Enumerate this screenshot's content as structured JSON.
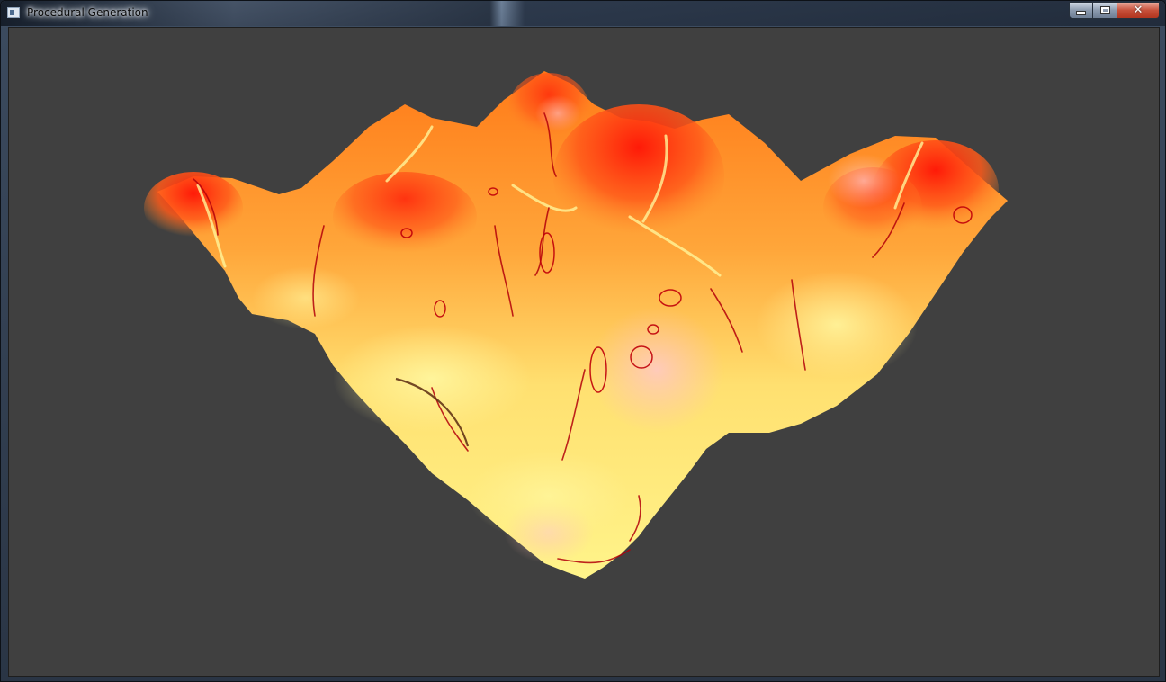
{
  "window": {
    "title": "Procedural Generation",
    "controls": {
      "minimize_icon": "minimize-icon",
      "maximize_icon": "maximize-icon",
      "close_icon": "close-icon"
    }
  },
  "viewport": {
    "background_color": "#404040",
    "scene": "procedural-terrain-mesh",
    "palette": {
      "low": "#ffef7a",
      "mid": "#ff9a2a",
      "high": "#ff2a10",
      "line": "#b3000a"
    }
  }
}
